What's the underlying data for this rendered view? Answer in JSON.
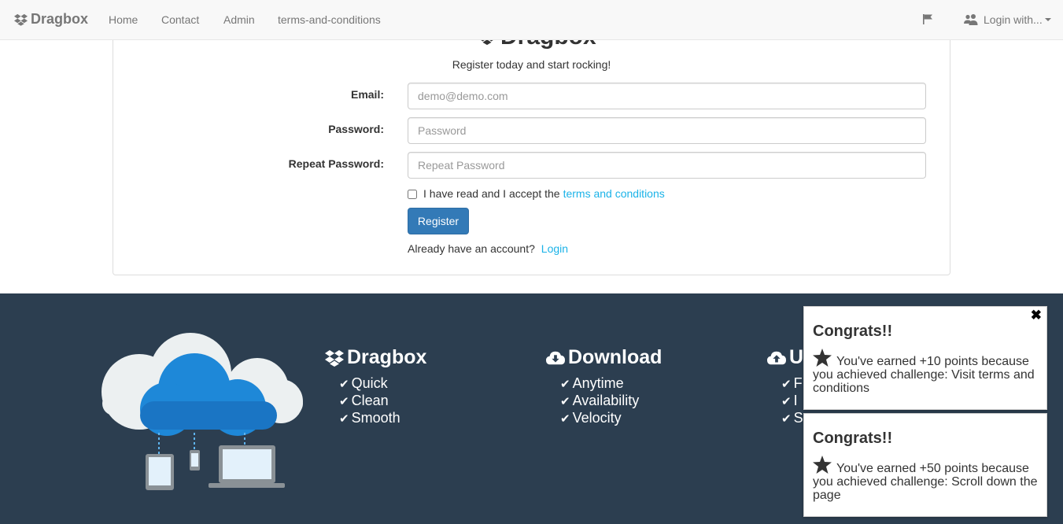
{
  "navbar": {
    "brand": "Dragbox",
    "links": [
      "Home",
      "Contact",
      "Admin",
      "terms-and-conditions"
    ],
    "login_label": "Login with..."
  },
  "form": {
    "logo_text": "Dragbox",
    "tagline": "Register today and start rocking!",
    "email_label": "Email:",
    "email_placeholder": "demo@demo.com",
    "password_label": "Password:",
    "password_placeholder": "Password",
    "repeat_label": "Repeat Password:",
    "repeat_placeholder": "Repeat Password",
    "terms_text": "I have read and I accept the",
    "terms_link": "terms and conditions",
    "register_button": "Register",
    "account_text": "Already have an account?",
    "login_link": "Login"
  },
  "footer": {
    "columns": [
      {
        "title": "Dragbox",
        "icon": "dropbox-icon",
        "items": [
          "Quick",
          "Clean",
          "Smooth"
        ]
      },
      {
        "title": "Download",
        "icon": "cloud-download-icon",
        "items": [
          "Anytime",
          "Availability",
          "Velocity"
        ]
      },
      {
        "title": "U",
        "icon": "cloud-upload-icon",
        "items": [
          "F",
          "I",
          "S"
        ]
      }
    ]
  },
  "notifications": [
    {
      "title": "Congrats!!",
      "message": "You've earned +10 points because you achieved challenge: Visit terms and conditions"
    },
    {
      "title": "Congrats!!",
      "message": "You've earned +50 points because you achieved challenge: Scroll down the page"
    }
  ],
  "colors": {
    "footer_bg": "#2c3e50",
    "primary_button": "#337ab7",
    "link": "#1bb3e8"
  }
}
